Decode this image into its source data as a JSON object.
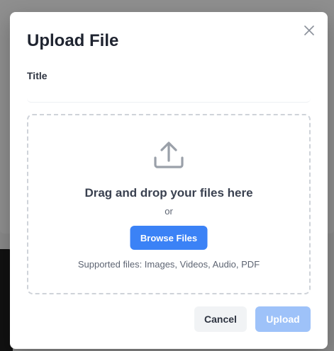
{
  "modal": {
    "title": "Upload File",
    "close_icon": "close-icon",
    "title_field": {
      "label": "Title",
      "value": "",
      "placeholder": ""
    },
    "dropzone": {
      "icon": "upload-icon",
      "heading": "Drag and drop your files here",
      "or_text": "or",
      "browse_label": "Browse Files",
      "supported_text": "Supported files: Images, Videos, Audio, PDF"
    },
    "footer": {
      "cancel_label": "Cancel",
      "upload_label": "Upload",
      "upload_disabled": true
    }
  },
  "colors": {
    "primary": "#3b82f6",
    "primary_disabled": "#9ec2f9",
    "overlay": "#8a8a8a"
  }
}
